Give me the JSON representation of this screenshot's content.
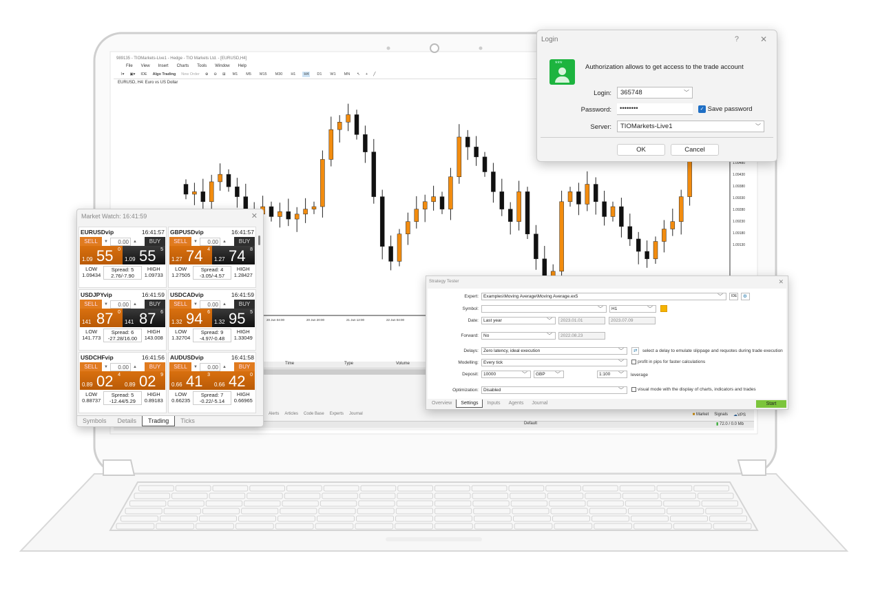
{
  "terminal": {
    "title": "989135 - TIOMarkets-Live1 - Hedge - TIO Markets Ltd. - [EURUSD,H4]",
    "menu": [
      "File",
      "View",
      "Insert",
      "Charts",
      "Tools",
      "Window",
      "Help"
    ],
    "toolbar": {
      "ide": "IDE",
      "algo_trading": "Algo Trading",
      "new_order": "New Order",
      "timeframes": [
        "M1",
        "M5",
        "M15",
        "M30",
        "H1",
        "H4",
        "D1",
        "W1",
        "MN"
      ],
      "selected_timeframe": "H4"
    },
    "chart_label": "EURUSD, H4: Euro vs US Dollar",
    "time_labels": [
      "20 Jun 04:00",
      "20 Jun 20:00",
      "21 Jun 12:00",
      "22 Jun 04:00",
      "22 Jun 20:00",
      "23 Jun 12:00",
      "26 Jun 04:00",
      "26 Jun 2"
    ],
    "price_labels": [
      "1.09480",
      "1.09430",
      "1.09380",
      "1.09330",
      "1.09280",
      "1.09230",
      "1.09180",
      "1.09130"
    ],
    "candles_close": [
      1.0961,
      1.0962,
      1.0958,
      1.0966,
      1.0969,
      1.0964,
      1.096,
      1.0955,
      1.0953,
      1.0956,
      1.0952,
      1.0954,
      1.0951,
      1.0953,
      1.0955,
      1.0956,
      1.0975,
      1.0987,
      1.099,
      1.0993,
      1.0985,
      1.0978,
      1.096,
      1.094,
      1.0934,
      1.0945,
      1.095,
      1.0955,
      1.0958,
      1.096,
      1.0955,
      1.0968,
      1.0984,
      1.098,
      1.0976,
      1.097,
      1.0962,
      1.0955,
      1.095,
      1.0962,
      1.0945,
      1.0935,
      1.0925,
      1.093,
      1.0958,
      1.0962,
      1.0957,
      1.0965,
      1.0958,
      1.0952,
      1.0956,
      1.0948,
      1.0943,
      1.0938,
      1.0935,
      1.0942,
      1.0947,
      1.095,
      1.096,
      1.0975
    ],
    "colors": {
      "bull": "#f28c0f",
      "bear": "#111111"
    },
    "trade_columns": [
      "Time",
      "Type",
      "Volume"
    ],
    "bottom_tabs": [
      "Alerts",
      "Articles",
      "Code Base",
      "Experts",
      "Journal"
    ],
    "status": {
      "market": "Market",
      "signals": "Signals",
      "vps": "VPS",
      "profile": "Default",
      "traffic": "72.0 / 0.0 Mb"
    }
  },
  "market_watch": {
    "title": "Market Watch: 16:41:59",
    "tiles": [
      {
        "symbol": "EURUSDvip",
        "time": "16:41:57",
        "sell": "SELL",
        "buy": "BUY",
        "volume": "0.00",
        "bid_pre": "1.09",
        "bid_big": "55",
        "bid_sup": "0",
        "ask_pre": "1.09",
        "ask_big": "55",
        "ask_sup": "5",
        "low_label": "LOW",
        "low": "1.09434",
        "spread": "Spread: 5",
        "swap": "2.76/-7.90",
        "high_label": "HIGH",
        "high": "1.09733",
        "buy_orange": false
      },
      {
        "symbol": "GBPUSDvip",
        "time": "16:41:57",
        "sell": "SELL",
        "buy": "BUY",
        "volume": "0.00",
        "bid_pre": "1.27",
        "bid_big": "74",
        "bid_sup": "4",
        "ask_pre": "1.27",
        "ask_big": "74",
        "ask_sup": "8",
        "low_label": "LOW",
        "low": "1.27505",
        "spread": "Spread: 4",
        "swap": "-3.05/-4.57",
        "high_label": "HIGH",
        "high": "1.28427",
        "buy_orange": false
      },
      {
        "symbol": "USDJPYvip",
        "time": "16:41:59",
        "sell": "SELL",
        "buy": "BUY",
        "volume": "0.00",
        "bid_pre": "141",
        "bid_big": "87",
        "bid_sup": "0",
        "ask_pre": "141",
        "ask_big": "87",
        "ask_sup": "6",
        "low_label": "LOW",
        "low": "141.773",
        "spread": "Spread: 6",
        "swap": "-27.28/16.00",
        "high_label": "HIGH",
        "high": "143.008",
        "buy_orange": false
      },
      {
        "symbol": "USDCADvip",
        "time": "16:41:59",
        "sell": "SELL",
        "buy": "BUY",
        "volume": "0.00",
        "bid_pre": "1.32",
        "bid_big": "94",
        "bid_sup": "6",
        "ask_pre": "1.32",
        "ask_big": "95",
        "ask_sup": "5",
        "low_label": "LOW",
        "low": "1.32704",
        "spread": "Spread: 9",
        "swap": "-4.97/-0.48",
        "high_label": "HIGH",
        "high": "1.33049",
        "buy_orange": false
      },
      {
        "symbol": "USDCHFvip",
        "time": "16:41:56",
        "sell": "SELL",
        "buy": "BUY",
        "volume": "0.00",
        "bid_pre": "0.89",
        "bid_big": "02",
        "bid_sup": "4",
        "ask_pre": "0.89",
        "ask_big": "02",
        "ask_sup": "9",
        "low_label": "LOW",
        "low": "0.88737",
        "spread": "Spread: 5",
        "swap": "-12.44/5.29",
        "high_label": "HIGH",
        "high": "0.89183",
        "buy_orange": true
      },
      {
        "symbol": "AUDUSDvip",
        "time": "16:41:58",
        "sell": "SELL",
        "buy": "BUY",
        "volume": "0.00",
        "bid_pre": "0.66",
        "bid_big": "41",
        "bid_sup": "3",
        "ask_pre": "0.66",
        "ask_big": "42",
        "ask_sup": "0",
        "low_label": "LOW",
        "low": "0.66235",
        "spread": "Spread: 7",
        "swap": "-0.22/-5.14",
        "high_label": "HIGH",
        "high": "0.66965",
        "buy_orange": true
      }
    ],
    "tabs": [
      "Symbols",
      "Details",
      "Trading",
      "Ticks"
    ],
    "active_tab": "Trading"
  },
  "login": {
    "title": "Login",
    "help": "?",
    "message": "Authorization allows to get access to the trade account",
    "login_label": "Login:",
    "login_value": "365748",
    "password_label": "Password:",
    "password_value": "••••••••",
    "save_password_label": "Save password",
    "save_password_checked": true,
    "server_label": "Server:",
    "server_value": "TIOMarkets-Live1",
    "ok": "OK",
    "cancel": "Cancel"
  },
  "strategy_tester": {
    "title": "Strategy Tester",
    "expert_label": "Expert:",
    "expert": "Examples\\Moving Average\\Moving Average.ex5",
    "ide": "IDE",
    "symbol_label": "Symbol:",
    "symbol": "",
    "period": "H1",
    "date_label": "Date:",
    "date": "Last year",
    "date_from": "2023.01.01",
    "date_to": "2023.07.09",
    "forward_label": "Forward:",
    "forward": "No",
    "forward_date": "2022.08.23",
    "delays_label": "Delays:",
    "delays": "Zero latency, ideal execution",
    "delays_note": "select a delay to emulate slippage and requotes during trade execution",
    "modelling_label": "Modelling:",
    "modelling": "Every tick",
    "pips_note": "profit in pips for faster calculations",
    "deposit_label": "Deposit:",
    "deposit": "10000",
    "currency": "GBP",
    "leverage_value": "1:100",
    "leverage_label": "leverage",
    "optimization_label": "Optimization:",
    "optimization": "Disabled",
    "visual_note": "visual mode with the display of charts, indicators and trades",
    "tabs": [
      "Overview",
      "Settings",
      "Inputs",
      "Agents",
      "Journal"
    ],
    "active_tab": "Settings",
    "start": "Start"
  }
}
